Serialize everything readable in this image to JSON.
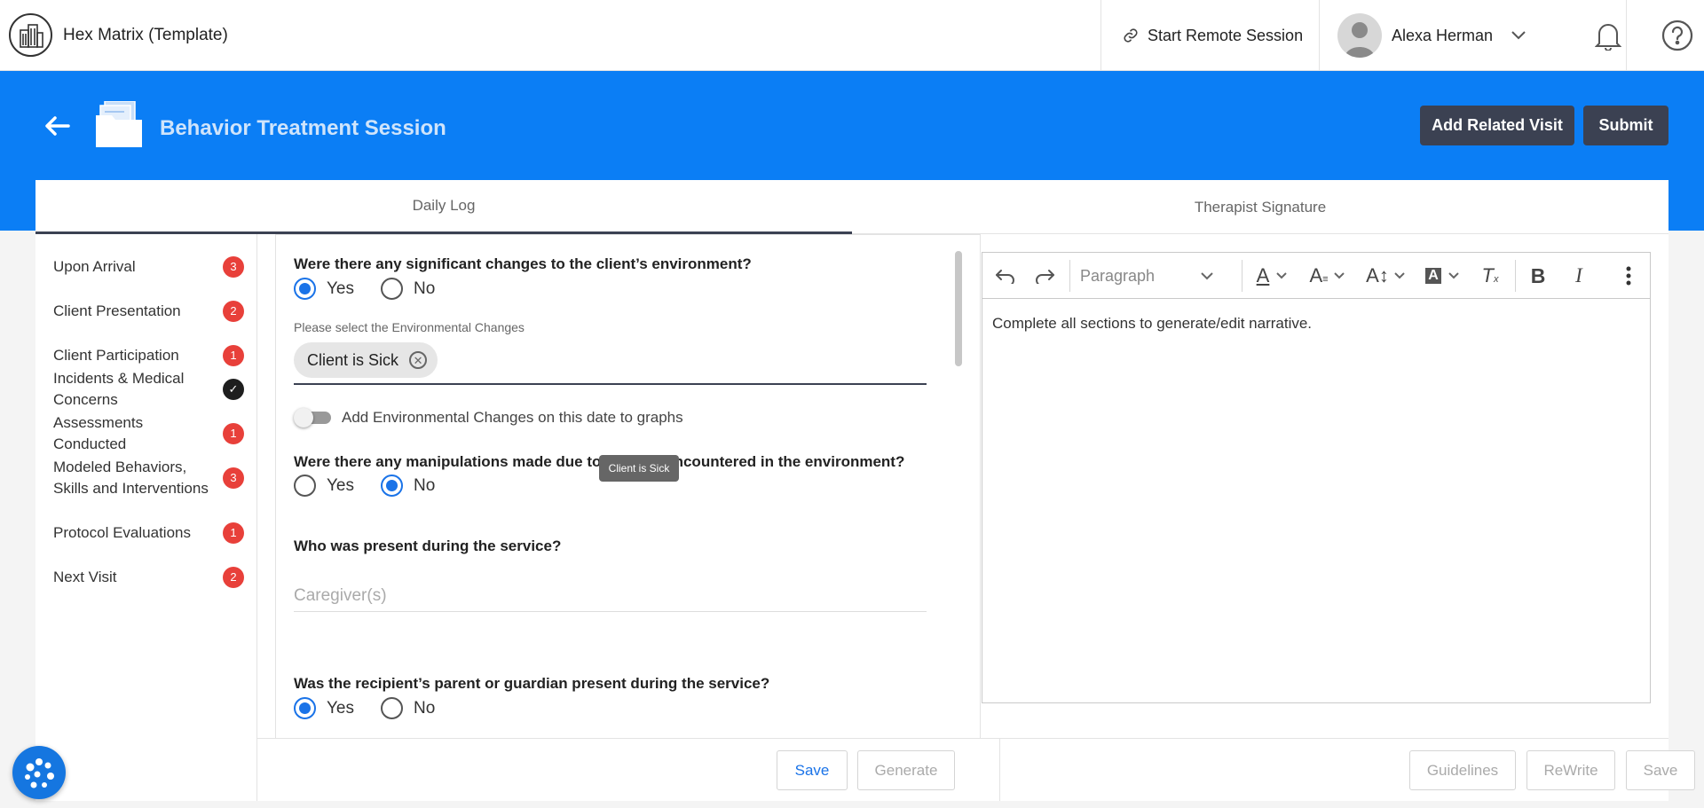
{
  "app": {
    "title": "Hex Matrix (Template)"
  },
  "header": {
    "remote_session": "Start Remote Session",
    "user_name": "Alexa Herman"
  },
  "page": {
    "title": "Behavior Treatment Session",
    "add_related_visit": "Add Related Visit",
    "submit": "Submit"
  },
  "tabs": [
    {
      "label": "Daily Log",
      "active": true
    },
    {
      "label": "Therapist Signature",
      "active": false
    }
  ],
  "sidebar": {
    "items": [
      {
        "label": "Upon Arrival",
        "badge": "3"
      },
      {
        "label": "Client Presentation",
        "badge": "2"
      },
      {
        "label": "Client Participation",
        "badge": "1"
      },
      {
        "label": "Incidents & Medical Concerns",
        "badge": "✓"
      },
      {
        "label": "Assessments Conducted",
        "badge": "1"
      },
      {
        "label": "Modeled Behaviors, Skills and Interventions",
        "badge": "3"
      },
      {
        "label": "Protocol Evaluations",
        "badge": "1"
      },
      {
        "label": "Next Visit",
        "badge": "2"
      }
    ]
  },
  "form": {
    "q1": "Were there any significant changes to the client’s environment?",
    "q1_selected": "Yes",
    "env_label": "Please select the Environmental Changes",
    "chip": "Client is Sick",
    "toggle_label": "Add Environmental Changes on this date to graphs",
    "toggle_on": false,
    "q2": "Were there any manipulations made due to barriers encountered in the environment?",
    "q2_selected": "No",
    "tooltip": "Client is Sick",
    "q3": "Who was present during the service?",
    "caregiver_placeholder": "Caregiver(s)",
    "q4": "Was the recipient’s parent or guardian present during the service?",
    "q4_selected": "Yes",
    "yes": "Yes",
    "no": "No"
  },
  "editor": {
    "block_style": "Paragraph",
    "content": "Complete all sections to generate/edit narrative."
  },
  "footer_left": {
    "save": "Save",
    "generate": "Generate"
  },
  "footer_right": {
    "guidelines": "Guidelines",
    "rewrite": "ReWrite",
    "save": "Save"
  },
  "colors": {
    "brand_blue": "#0b7ef5",
    "dark_button": "#3b4152",
    "badge_red": "#e8403a",
    "radio_blue": "#1a73e8"
  }
}
